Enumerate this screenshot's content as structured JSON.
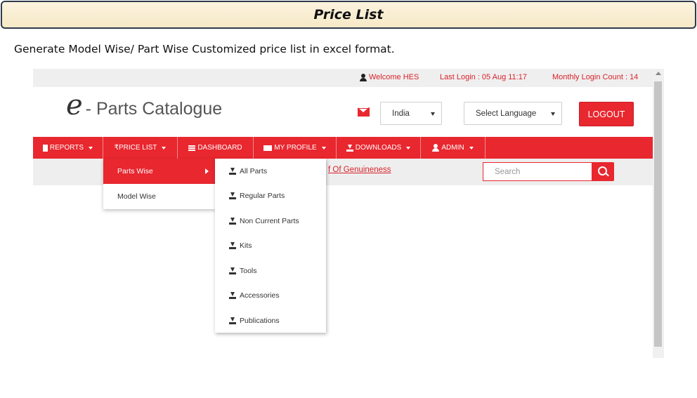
{
  "slide": {
    "title": "Price List",
    "description": "Generate Model Wise/ Part Wise Customized price list in excel format."
  },
  "topbar": {
    "welcome": "Welcome HES",
    "last_login": "Last Login : 05 Aug 11:17",
    "login_count": "Monthly Login Count : 14"
  },
  "header": {
    "logo_e": "e",
    "logo_text": "- Parts Catalogue",
    "country": "India",
    "language": "Select Language",
    "logout_label": "LOGOUT"
  },
  "nav": {
    "reports": "REPORTS",
    "price_list": "₹PRICE LIST",
    "dashboard": "DASHBOARD",
    "my_profile": "MY PROFILE",
    "downloads": "DOWNLOADS",
    "admin": "ADMIN"
  },
  "subbar": {
    "genuineness_link": "f Of Genuineness",
    "search_placeholder": "Search"
  },
  "price_menu": {
    "items": [
      "Parts Wise",
      "Model Wise"
    ]
  },
  "parts_submenu": {
    "items": [
      "All Parts",
      "Regular Parts",
      "Non Current Parts",
      "Kits",
      "Tools",
      "Accessories",
      "Publications"
    ]
  },
  "colors": {
    "brand_red": "#e8272f",
    "banner_bg": "#f6e9c7"
  },
  "icons": [
    "user-icon",
    "mail-icon",
    "document-icon",
    "menu-icon",
    "envelope-icon",
    "download-icon",
    "search-icon"
  ]
}
